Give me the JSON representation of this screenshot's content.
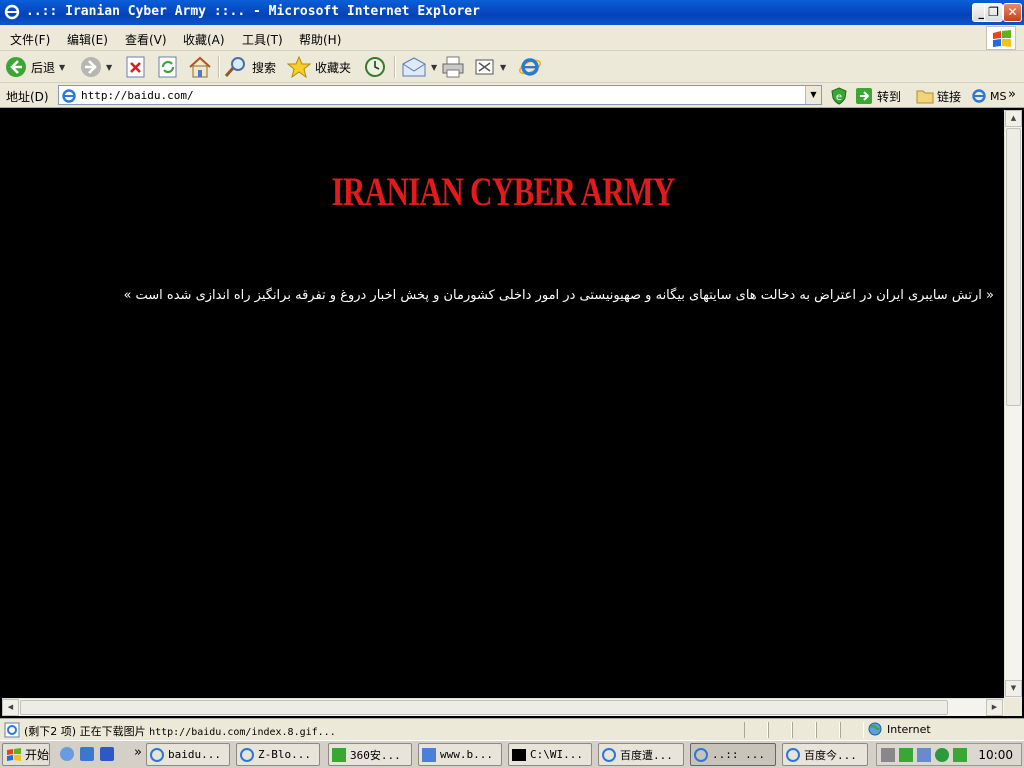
{
  "window": {
    "title": "..:: Iranian Cyber Army ::.. - Microsoft Internet Explorer",
    "min_glyph": "_",
    "max_glyph": "❐",
    "close_glyph": "✕"
  },
  "menu": [
    "文件(F)",
    "编辑(E)",
    "查看(V)",
    "收藏(A)",
    "工具(T)",
    "帮助(H)"
  ],
  "toolbar": {
    "back_label": "后退",
    "search_label": "搜索",
    "favorites_label": "收藏夹"
  },
  "address": {
    "label": "地址(D)",
    "value": "http://baidu.com/",
    "go_label": "转到",
    "links_label": "链接",
    "ms_label": "MS",
    "more_glyph": "»"
  },
  "page": {
    "heading": "IRANIAN CYBER ARMY",
    "message": "« ارتش سایبری ایران در اعتراض به دخالت های سایتهای بیگانه و صهیونیستی در امور داخلی کشورمان و پخش اخبار دروغ و تفرقه برانگیز راه اندازی شده است »"
  },
  "status": {
    "text": "(剩下2 项) 正在下载图片",
    "url": "http://baidu.com/index.8.gif...",
    "zone": "Internet"
  },
  "taskbar": {
    "start_label": "开始",
    "more_glyph": "»",
    "tasks": [
      "baidu...",
      "Z-Blo...",
      "360安...",
      "www.b...",
      "C:\\WI...",
      "百度遭...",
      "..:: ...",
      "百度今..."
    ],
    "clock": "10:00"
  },
  "colors": {
    "title_blue": "#0442b8",
    "heading_red": "#e01b1b",
    "page_bg": "#000000",
    "chrome": "#ece9d8"
  },
  "icons": {
    "app": "ie-icon",
    "back": "back-arrow-icon",
    "forward": "forward-arrow-icon",
    "stop": "stop-icon",
    "refresh": "refresh-icon",
    "home": "home-icon",
    "search": "search-icon",
    "favorites": "star-icon",
    "history": "history-icon",
    "mail": "mail-icon",
    "print": "print-icon",
    "edit": "edit-icon",
    "messenger": "ie-icon"
  }
}
